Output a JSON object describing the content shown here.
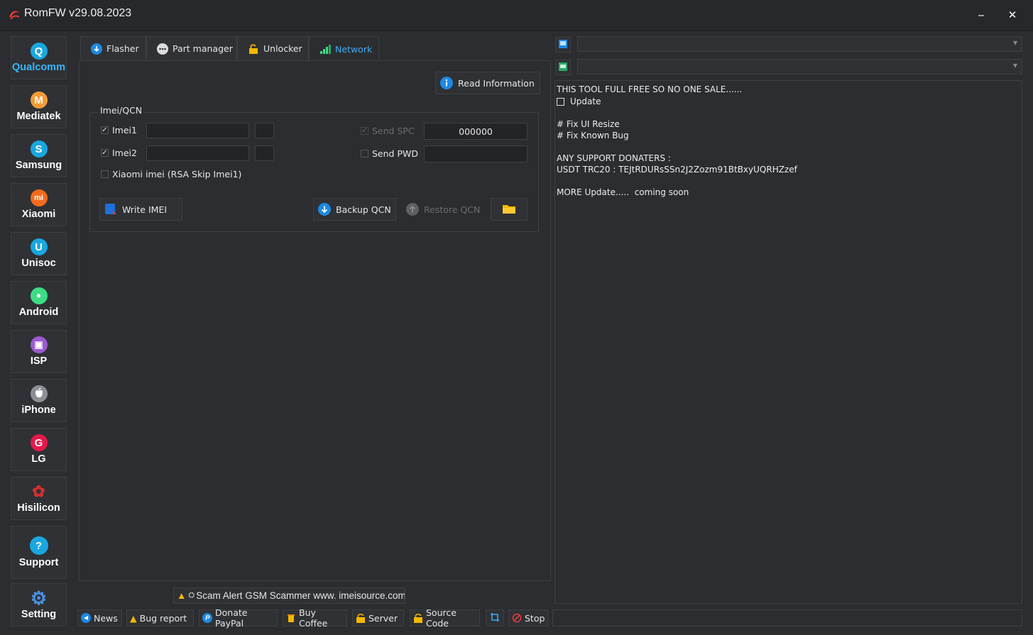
{
  "window": {
    "title": "RomFW v29.08.2023",
    "minimize": "‒",
    "close": "✕"
  },
  "sidebar": {
    "items": [
      {
        "label": "Qualcomm",
        "glyph": "Q",
        "color": "#1aa7e0",
        "active": true
      },
      {
        "label": "Mediatek",
        "glyph": "M",
        "color": "#f39c38"
      },
      {
        "label": "Samsung",
        "glyph": "S",
        "color": "#1aa7e0"
      },
      {
        "label": "Xiaomi",
        "glyph": "mi",
        "color": "#f26b1d"
      },
      {
        "label": "Unisoc",
        "glyph": "U",
        "color": "#1aa7e0"
      },
      {
        "label": "Android",
        "glyph": "•",
        "color": "#3ddc84"
      },
      {
        "label": "ISP",
        "glyph": "▣",
        "color": "#9b59d0"
      },
      {
        "label": "iPhone",
        "glyph": "",
        "color": "#b8bcc2"
      },
      {
        "label": "LG",
        "glyph": "G",
        "color": "#e6194b"
      },
      {
        "label": "Hisilicon",
        "glyph": "✿",
        "color": "#d32f2f"
      },
      {
        "label": "Support",
        "glyph": "?",
        "color": "#1aa7e0"
      },
      {
        "label": "Setting",
        "glyph": "⚙",
        "color": "#4a90e2"
      }
    ]
  },
  "tabs": [
    {
      "label": "Flasher"
    },
    {
      "label": "Part manager"
    },
    {
      "label": "Unlocker"
    },
    {
      "label": "Network",
      "active": true
    }
  ],
  "network": {
    "read_info_label": "Read Information",
    "group_title": "Imei/QCN",
    "imei1": {
      "label": "Imei1",
      "checked": "✓",
      "value": ""
    },
    "imei2": {
      "label": "Imei2",
      "checked": "✓",
      "value": ""
    },
    "xiaomi_label": "Xiaomi imei (RSA Skip Imei1)",
    "send_spc": {
      "label": "Send SPC",
      "checked": "✓",
      "value": "000000"
    },
    "send_pwd": {
      "label": "Send PWD",
      "value": ""
    },
    "write_imei_label": "Write IMEI",
    "backup_qcn_label": "Backup QCN",
    "restore_qcn_label": "Restore QCN"
  },
  "log": {
    "lines": [
      "THIS TOOL FULL FREE SO NO ONE SALE......",
      "Update",
      "# Fix UI Resize",
      "# Fix Known Bug",
      "ANY SUPPORT DONATERS :",
      "USDT TRC20 : TEJtRDURsSSn2J2Zozm91BtBxyUQRHZzef",
      "MORE Update.....  coming soon"
    ]
  },
  "scam_alert": "Scam Alert GSM Scammer www. imeisource.com",
  "bottom": {
    "news": "News",
    "bug_report": "Bug report",
    "donate": "Donate PayPal",
    "coffee": "Buy Coffee",
    "server": "Server",
    "source_code": "Source Code",
    "stop": "Stop"
  },
  "colors": {
    "background": "#2b2d30",
    "accent": "#3fa9f5"
  }
}
